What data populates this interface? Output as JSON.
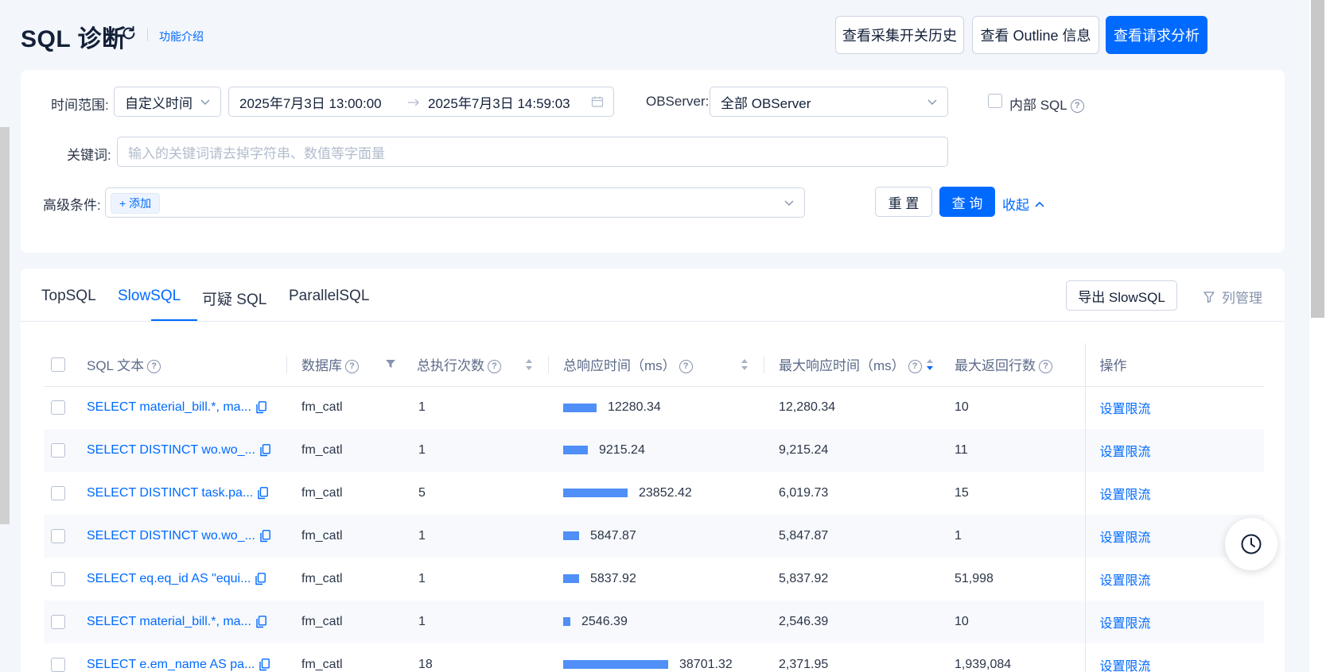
{
  "header": {
    "title": "SQL 诊断",
    "intro_link": "功能介绍",
    "buttons": {
      "collect_history": "查看采集开关历史",
      "outline_info": "查看 Outline 信息",
      "request_analysis": "查看请求分析"
    }
  },
  "filters": {
    "time_range_label": "时间范围:",
    "time_range_type": "自定义时间",
    "start_time": "2025年7月3日 13:00:00",
    "end_time": "2025年7月3日 14:59:03",
    "observer_label": "OBServer:",
    "observer_value": "全部 OBServer",
    "internal_sql_label": "内部 SQL",
    "keyword_label": "关键词:",
    "keyword_placeholder": "输入的关键词请去掉字符串、数值等字面量",
    "advanced_label": "高级条件:",
    "add_label": "+ 添加",
    "reset_label": "重 置",
    "query_label": "查 询",
    "collapse_label": "收起"
  },
  "tabs": {
    "items": [
      "TopSQL",
      "SlowSQL",
      "可疑 SQL",
      "ParallelSQL"
    ],
    "active": "SlowSQL",
    "export_label": "导出 SlowSQL",
    "column_mgmt_label": "列管理"
  },
  "table": {
    "headers": {
      "sql_text": "SQL 文本",
      "database": "数据库",
      "exec_count": "总执行次数",
      "total_resp": "总响应时间（ms）",
      "max_resp": "最大响应时间（ms）",
      "max_rows": "最大返回行数",
      "action": "操作"
    },
    "bar_max": 40000,
    "rows": [
      {
        "sql": "SELECT material_bill.*, ma...",
        "db": "fm_catl",
        "count": "1",
        "total": "12280.34",
        "total_value": 12280.34,
        "max": "12,280.34",
        "rows": "10",
        "action": "设置限流"
      },
      {
        "sql": "SELECT DISTINCT wo.wo_...",
        "db": "fm_catl",
        "count": "1",
        "total": "9215.24",
        "total_value": 9215.24,
        "max": "9,215.24",
        "rows": "11",
        "action": "设置限流"
      },
      {
        "sql": "SELECT DISTINCT task.pa...",
        "db": "fm_catl",
        "count": "5",
        "total": "23852.42",
        "total_value": 23852.42,
        "max": "6,019.73",
        "rows": "15",
        "action": "设置限流"
      },
      {
        "sql": "SELECT DISTINCT wo.wo_...",
        "db": "fm_catl",
        "count": "1",
        "total": "5847.87",
        "total_value": 5847.87,
        "max": "5,847.87",
        "rows": "1",
        "action": "设置限流"
      },
      {
        "sql": "SELECT eq.eq_id AS \"equi...",
        "db": "fm_catl",
        "count": "1",
        "total": "5837.92",
        "total_value": 5837.92,
        "max": "5,837.92",
        "rows": "51,998",
        "action": "设置限流"
      },
      {
        "sql": "SELECT material_bill.*, ma...",
        "db": "fm_catl",
        "count": "1",
        "total": "2546.39",
        "total_value": 2546.39,
        "max": "2,546.39",
        "rows": "10",
        "action": "设置限流"
      },
      {
        "sql": "SELECT e.em_name AS pa...",
        "db": "fm_catl",
        "count": "18",
        "total": "38701.32",
        "total_value": 38701.32,
        "max": "2,371.95",
        "rows": "1,939,084",
        "action": "设置限流"
      }
    ]
  },
  "colors": {
    "primary": "#006aff",
    "bar": "#4f8ff7",
    "background": "#f3f6fb"
  }
}
